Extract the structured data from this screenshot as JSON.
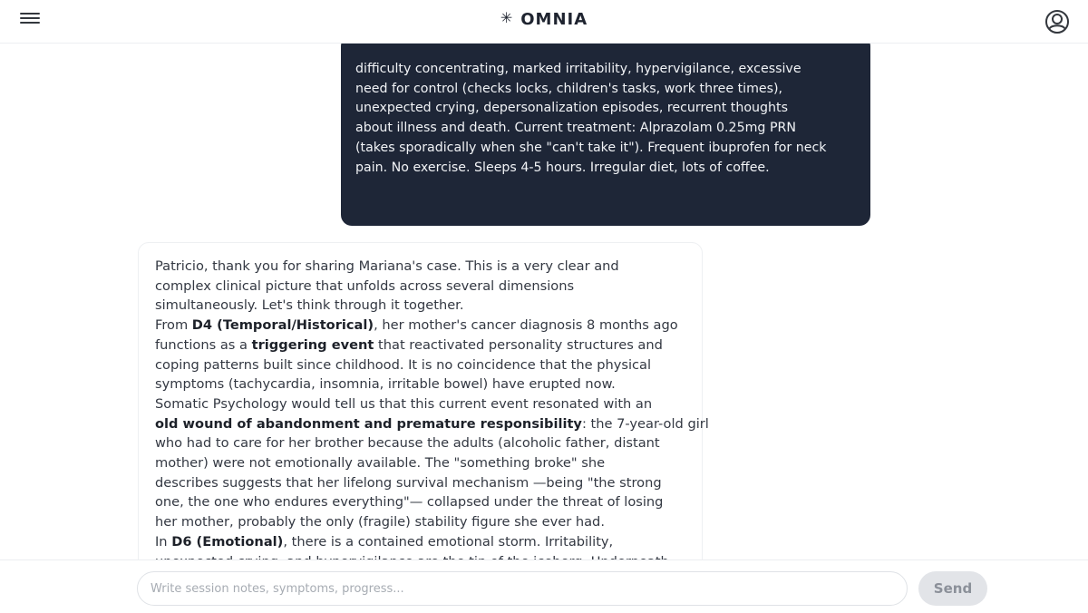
{
  "header": {
    "brand_icon": "✳",
    "title": "OMNIA",
    "menu_icon": "hamburger-menu-icon",
    "profile_icon": "user-profile-icon"
  },
  "user_message": {
    "lines": [
      "difficulty concentrating, marked irritability, hypervigilance, excessive",
      "need for control (checks locks, children's tasks, work three times),",
      "unexpected crying, depersonalization episodes, recurrent thoughts",
      "about illness and death. Current treatment: Alprazolam 0.25mg PRN",
      "(takes sporadically when she \"can't take it\"). Frequent ibuprofen for neck",
      "pain. No exercise. Sleeps 4-5 hours. Irregular diet, lots of coffee."
    ]
  },
  "assistant_message": {
    "l1": "Patricio, thank you for sharing Mariana's case. This is a very clear and",
    "l2": "complex clinical picture that unfolds across several dimensions",
    "l3": "simultaneously. Let's think through it together.",
    "l4_pre": "From ",
    "l4_bold": "D4 (Temporal/Historical)",
    "l4_post": ", her mother's cancer diagnosis 8 months ago",
    "l5_pre": "functions as a ",
    "l5_bold": "triggering event",
    "l5_post": " that reactivated personality structures and",
    "l6": "coping patterns built since childhood. It is no coincidence that the physical",
    "l7": "symptoms (tachycardia, insomnia, irritable bowel) have erupted now.",
    "l8": "Somatic Psychology would tell us that this current event resonated with an",
    "l9_bold": "old wound of abandonment and premature responsibility",
    "l9_post": ": the 7-year-old girl",
    "l10": "who had to care for her brother because the adults (alcoholic father, distant",
    "l11": "mother) were not emotionally available. The \"something broke\" she",
    "l12": "describes suggests that her lifelong survival mechanism —being \"the strong",
    "l13": "one, the one who endures everything\"— collapsed under the threat of losing",
    "l14": "her mother, probably the only (fragile) stability figure she ever had.",
    "l15_pre": "In ",
    "l15_bold": "D6 (Emotional)",
    "l15_post": ", there is a contained emotional storm. Irritability,",
    "l16": "unexpected crying, and hypervigilance are the tip of the iceberg. Underneath"
  },
  "composer": {
    "placeholder": "Write session notes, symptoms, progress...",
    "value": "",
    "send_label": "Send"
  }
}
